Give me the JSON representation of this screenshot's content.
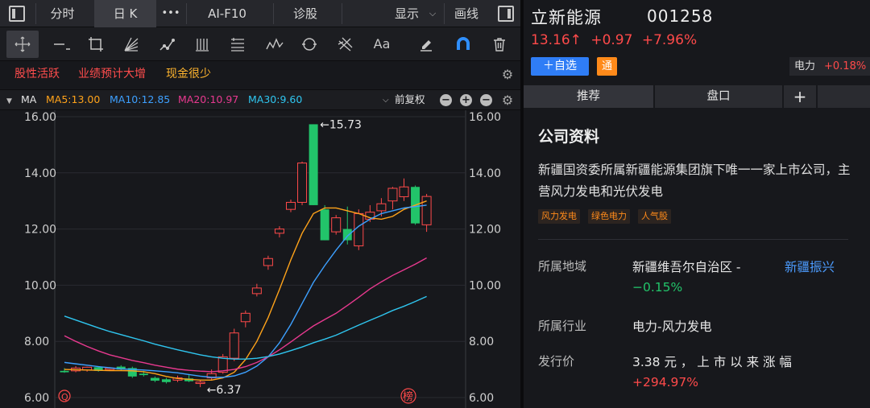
{
  "toolbar": {
    "fenshi": "分时",
    "rik": "日 K",
    "more": "•••",
    "aif10": "AI-F10",
    "zhengu": "诊股",
    "display": "显示",
    "display_chev": "⌵",
    "huaxian": "画线",
    "text_tool": "Aa"
  },
  "tags": [
    "股性活跃",
    "业绩预计大增",
    "现金很少"
  ],
  "ma_row": {
    "label": "MA",
    "ma5": "MA5:13.00",
    "ma10": "MA10:12.85",
    "ma20": "MA20:10.97",
    "ma30": "MA30:9.60",
    "adjust": "前复权",
    "adjust_chev": "⌵",
    "minus": "−",
    "plus": "+",
    "colors": {
      "ma5": "#ffa31a",
      "ma10": "#3da0ff",
      "ma20": "#e8398f",
      "ma30": "#2fc6f0"
    }
  },
  "chart_data": {
    "type": "candlestick",
    "y_axis": {
      "ticks": [
        "16.00",
        "14.00",
        "12.00",
        "10.00",
        "8.00",
        "6.00"
      ],
      "range": [
        6.0,
        16.0
      ]
    },
    "annotations": {
      "high": "←15.73",
      "low": "←6.37"
    },
    "corner_marks": {
      "left": "Q",
      "right": "榜"
    },
    "colors": {
      "up": "#ff4a4a",
      "down": "#22c46a",
      "grid": "#2a2b31",
      "axis_text": "#cfcfcf"
    },
    "candles": [
      {
        "o": 6.95,
        "h": 7.05,
        "l": 6.88,
        "c": 6.9
      },
      {
        "o": 6.95,
        "h": 7.12,
        "l": 6.9,
        "c": 7.05
      },
      {
        "o": 6.98,
        "h": 7.1,
        "l": 6.92,
        "c": 7.08
      },
      {
        "o": 7.08,
        "h": 7.12,
        "l": 6.92,
        "c": 6.95
      },
      {
        "o": 7.0,
        "h": 7.08,
        "l": 6.95,
        "c": 7.05
      },
      {
        "o": 7.1,
        "h": 7.15,
        "l": 6.95,
        "c": 7.0
      },
      {
        "o": 7.05,
        "h": 7.1,
        "l": 6.7,
        "c": 6.75
      },
      {
        "o": 6.85,
        "h": 6.95,
        "l": 6.75,
        "c": 6.8
      },
      {
        "o": 6.7,
        "h": 6.75,
        "l": 6.55,
        "c": 6.6
      },
      {
        "o": 6.65,
        "h": 6.7,
        "l": 6.5,
        "c": 6.55
      },
      {
        "o": 6.62,
        "h": 6.78,
        "l": 6.55,
        "c": 6.7
      },
      {
        "o": 6.68,
        "h": 6.8,
        "l": 6.55,
        "c": 6.58
      },
      {
        "o": 6.5,
        "h": 6.62,
        "l": 6.37,
        "c": 6.55
      },
      {
        "o": 6.7,
        "h": 7.0,
        "l": 6.6,
        "c": 6.85
      },
      {
        "o": 6.9,
        "h": 7.55,
        "l": 6.85,
        "c": 7.45
      },
      {
        "o": 7.4,
        "h": 8.45,
        "l": 7.3,
        "c": 8.3
      },
      {
        "o": 8.7,
        "h": 9.1,
        "l": 8.5,
        "c": 9.0
      },
      {
        "o": 9.7,
        "h": 10.05,
        "l": 9.6,
        "c": 9.9
      },
      {
        "o": 10.7,
        "h": 11.05,
        "l": 10.55,
        "c": 10.95
      },
      {
        "o": 11.85,
        "h": 12.1,
        "l": 11.7,
        "c": 12.0
      },
      {
        "o": 12.7,
        "h": 13.05,
        "l": 12.6,
        "c": 12.95
      },
      {
        "o": 12.95,
        "h": 14.4,
        "l": 12.85,
        "c": 14.35
      },
      {
        "o": 15.73,
        "h": 15.73,
        "l": 12.85,
        "c": 12.85
      },
      {
        "o": 12.7,
        "h": 12.85,
        "l": 11.6,
        "c": 11.6
      },
      {
        "o": 11.9,
        "h": 12.5,
        "l": 11.8,
        "c": 12.4
      },
      {
        "o": 12.0,
        "h": 12.8,
        "l": 11.45,
        "c": 11.6
      },
      {
        "o": 11.4,
        "h": 12.7,
        "l": 11.25,
        "c": 12.55
      },
      {
        "o": 12.35,
        "h": 12.85,
        "l": 12.25,
        "c": 12.6
      },
      {
        "o": 12.65,
        "h": 13.1,
        "l": 12.45,
        "c": 12.9
      },
      {
        "o": 13.0,
        "h": 13.5,
        "l": 12.7,
        "c": 13.45
      },
      {
        "o": 13.15,
        "h": 13.8,
        "l": 13.0,
        "c": 13.5
      },
      {
        "o": 13.5,
        "h": 13.55,
        "l": 12.15,
        "c": 12.2
      },
      {
        "o": 12.15,
        "h": 13.25,
        "l": 11.9,
        "c": 13.16
      }
    ],
    "ma5": [
      7.0,
      6.99,
      6.98,
      6.97,
      6.96,
      6.96,
      6.95,
      6.92,
      6.85,
      6.75,
      6.68,
      6.65,
      6.62,
      6.62,
      6.7,
      6.9,
      7.35,
      8.0,
      8.85,
      9.85,
      10.9,
      11.85,
      12.55,
      12.75,
      12.75,
      12.65,
      12.55,
      12.4,
      12.35,
      12.45,
      12.7,
      12.85,
      13.0
    ],
    "ma10": [
      7.25,
      7.2,
      7.15,
      7.1,
      7.06,
      7.02,
      7.0,
      6.98,
      6.95,
      6.92,
      6.88,
      6.82,
      6.76,
      6.72,
      6.72,
      6.77,
      6.9,
      7.12,
      7.45,
      7.95,
      8.6,
      9.35,
      10.1,
      10.7,
      11.25,
      11.75,
      12.1,
      12.35,
      12.55,
      12.65,
      12.75,
      12.8,
      12.85
    ],
    "ma20": [
      8.2,
      8.0,
      7.82,
      7.66,
      7.52,
      7.42,
      7.32,
      7.24,
      7.15,
      7.08,
      7.01,
      6.97,
      6.94,
      6.92,
      6.95,
      7.0,
      7.1,
      7.25,
      7.45,
      7.7,
      7.98,
      8.27,
      8.55,
      8.78,
      9.0,
      9.28,
      9.57,
      9.87,
      10.12,
      10.35,
      10.55,
      10.75,
      10.97
    ],
    "ma30": [
      8.9,
      8.76,
      8.62,
      8.48,
      8.35,
      8.24,
      8.13,
      8.02,
      7.9,
      7.8,
      7.7,
      7.61,
      7.52,
      7.45,
      7.4,
      7.37,
      7.37,
      7.4,
      7.46,
      7.55,
      7.67,
      7.8,
      7.95,
      8.08,
      8.22,
      8.4,
      8.58,
      8.75,
      8.92,
      9.1,
      9.25,
      9.42,
      9.6
    ]
  },
  "right": {
    "name": "立新能源",
    "code": "001258",
    "price": "13.16↑",
    "change": "+0.97",
    "change_pct": "+7.96%",
    "add_btn": "＋自选",
    "tong": "通",
    "sector_name": "电力",
    "sector_pct": "+0.18%",
    "tab_recommend": "推荐",
    "tab_pankou": "盘口",
    "tab_plus": "+",
    "company_title": "公司资料",
    "company_desc": "新疆国资委所属新疆能源集团旗下唯一一家上市公司，主营风力发电和光伏发电",
    "company_tags": [
      "风力发电",
      "绿色电力",
      "人气股"
    ],
    "region_label": "所属地域",
    "region_value": "新疆维吾尔自治区 -",
    "region_link": "新疆振兴",
    "region_pct": "−0.15%",
    "industry_label": "所属行业",
    "industry_value": "电力-风力发电",
    "ipo_label": "发行价",
    "ipo_value": "3.38 元 ， 上 市 以 来 涨 幅",
    "ipo_gain": "+294.97%"
  }
}
